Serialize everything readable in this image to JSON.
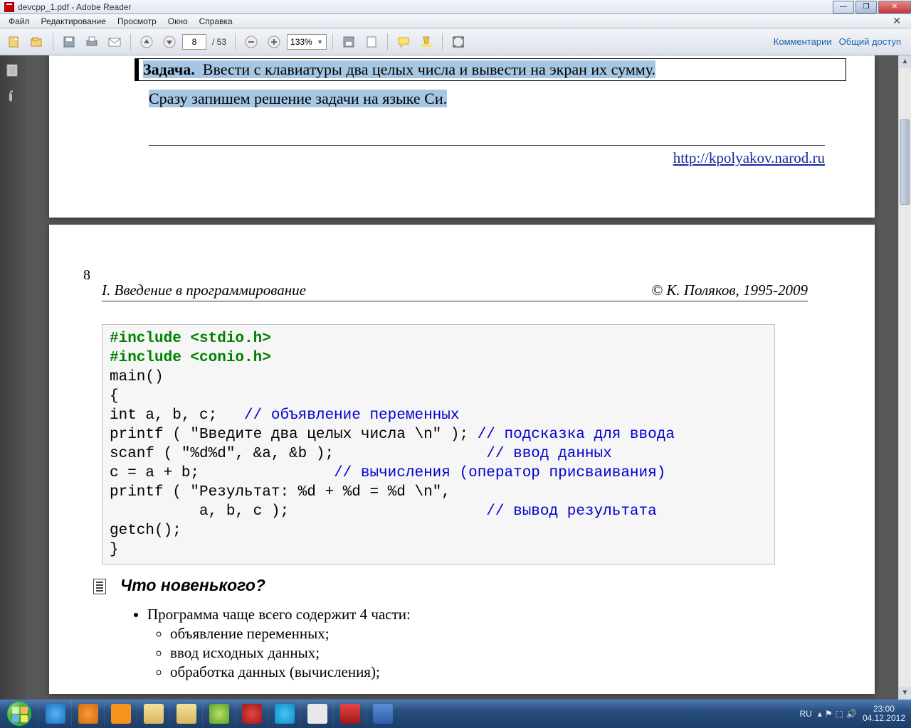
{
  "window": {
    "title": "devcpp_1.pdf - Adobe Reader"
  },
  "menu": {
    "file": "Файл",
    "edit": "Редактирование",
    "view": "Просмотр",
    "window": "Окно",
    "help": "Справка"
  },
  "toolbar": {
    "page_current": "8",
    "page_total": "/ 53",
    "zoom": "133%",
    "comments": "Комментарии",
    "share": "Общий доступ"
  },
  "doc": {
    "task_label": "Задача.",
    "task_text": "Ввести с клавиатуры два целых числа и вывести на экран их сумму.",
    "followup": "Сразу запишем решение задачи на языке Си.",
    "url": "http://kpolyakov.narod.ru",
    "page_num": "8",
    "chapter": "I. Введение в программирование",
    "copyright": "© К. Поляков, 1995-2009",
    "code": {
      "inc1": "#include <stdio.h>",
      "inc2": "#include <conio.h>",
      "l_main": "main()",
      "l_open": "{",
      "l_decl": "int a, b, c;   ",
      "c_decl": "// объявление переменных",
      "l_p1": "printf ( \"Введите два целых числа \\n\" ); ",
      "c_p1": "// подсказка для ввода",
      "l_scan": "scanf ( \"%d%d\", &a, &b );                 ",
      "c_scan": "// ввод данных",
      "l_calc": "c = a + b;               ",
      "c_calc": "// вычисления (оператор присваивания)",
      "l_p2a": "printf ( \"Результат: %d + %d = %d \\n\",",
      "l_p2b": "          a, b, c );                      ",
      "c_p2": "// вывод результата",
      "l_getch": "getch();",
      "l_close": "}"
    },
    "whatsnew": "Что новенького?",
    "bullet_main": "Программа чаще всего содержит 4 части:",
    "sub1": "объявление переменных;",
    "sub2": "ввод исходных данных;",
    "sub3": "обработка данных (вычисления);"
  },
  "systray": {
    "lang": "RU",
    "time": "23:00",
    "date": "04.12.2012"
  }
}
